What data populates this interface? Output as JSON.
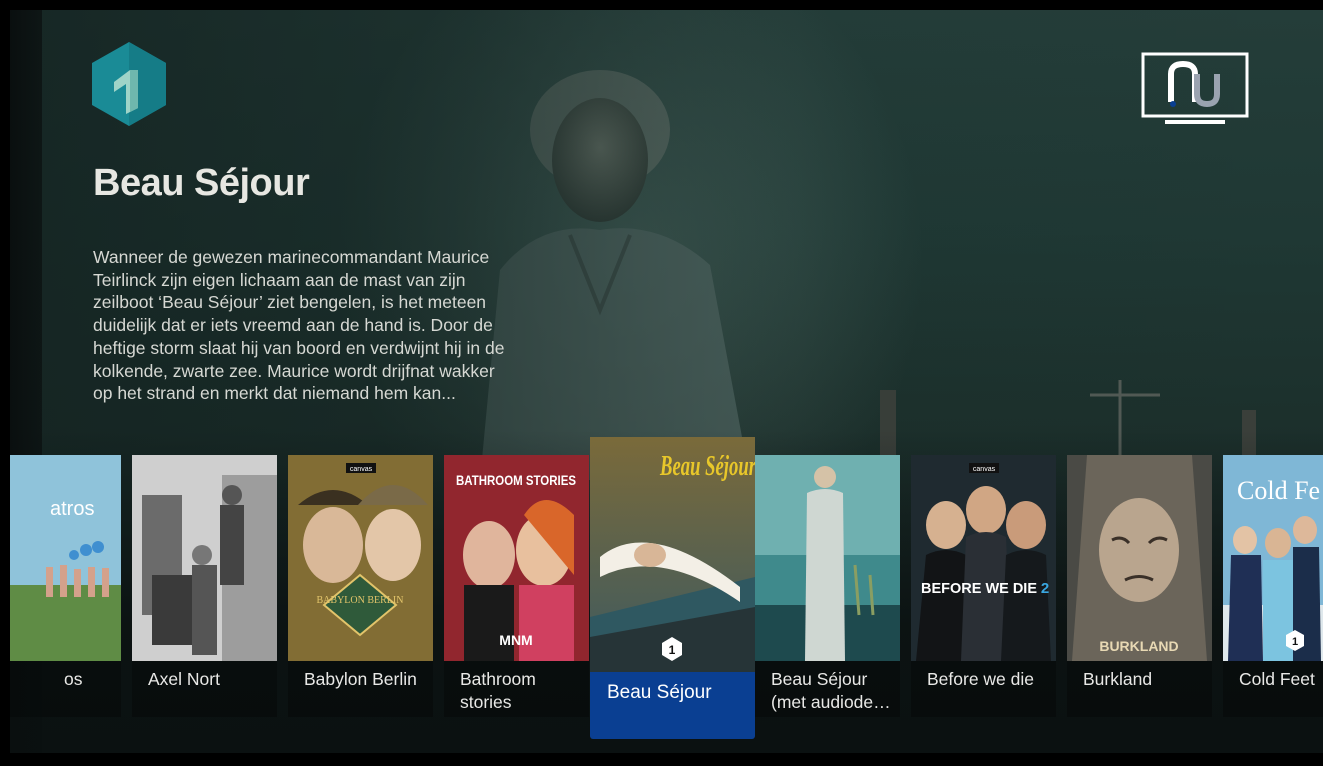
{
  "show": {
    "title": "Beau Séjour",
    "description": "Wanneer de gewezen marinecommandant Maurice Teirlinck zijn eigen lichaam aan de mast van zijn zeilboot ‘Beau Séjour’ ziet bengelen, is het meteen duidelijk dat er iets vreemd aan de hand is. Door de heftige storm slaat hij van boord en verdwijnt hij in de kolkende, zwarte zee. Maurice wordt drijfnat wakker op het strand en merkt dat niemand hem kan..."
  },
  "channel_logo": {
    "label": "1",
    "color": "#1a8b96"
  },
  "brand_logo": {
    "icon": "nu-tv-icon"
  },
  "carousel": {
    "items": [
      {
        "title": "Albatros",
        "visible_title": "os",
        "poster_text": "atros"
      },
      {
        "title": "Axel Nort"
      },
      {
        "title": "Babylon Berlin",
        "poster_text": "BABYLON BERLIN",
        "badge": "canvas"
      },
      {
        "title": "Bathroom stories",
        "poster_text": "BATHROOM STORIES",
        "badge": "MNM"
      },
      {
        "title": "Beau Séjour",
        "poster_text": "Beau Séjour",
        "badge": "1",
        "focused": true
      },
      {
        "title": "Beau Séjour (met audiodescriptie)",
        "visible_title": "Beau Séjour (met audiode…"
      },
      {
        "title": "Before we die",
        "poster_text": "BEFORE WE DIE",
        "poster_text_2": "2",
        "badge": "canvas"
      },
      {
        "title": "Burkland",
        "poster_text": "BURKLAND"
      },
      {
        "title": "Cold Feet",
        "poster_text": "Cold Fe",
        "badge": "1"
      }
    ]
  },
  "colors": {
    "focus": "#0a3f92",
    "background": "#1f3834"
  }
}
